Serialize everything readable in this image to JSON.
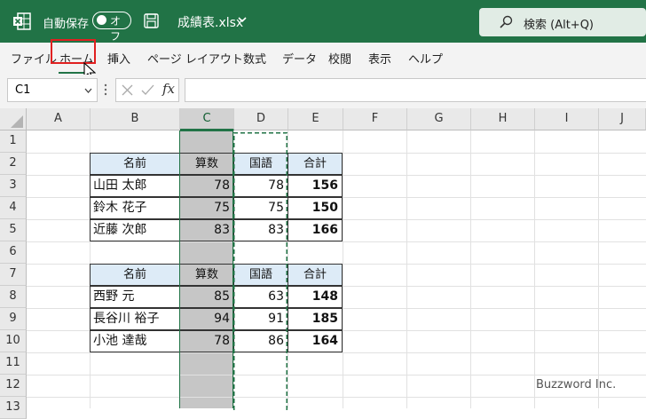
{
  "titlebar": {
    "autosave_label": "自動保存",
    "autosave_state": "オフ",
    "filename": "成績表.xlsx",
    "search_placeholder": "検索 (Alt+Q)",
    "brand_color": "#217346"
  },
  "menu": {
    "items": [
      "ファイル",
      "ホーム",
      "挿入",
      "ページ レイアウト",
      "数式",
      "データ",
      "校閲",
      "表示",
      "ヘルプ"
    ],
    "active": "ホーム"
  },
  "formula_bar": {
    "name_box": "C1",
    "fx": "fx",
    "formula": ""
  },
  "sheet": {
    "columns": [
      "A",
      "B",
      "C",
      "D",
      "E",
      "F",
      "G",
      "H",
      "I",
      "J"
    ],
    "rows": [
      "1",
      "2",
      "3",
      "4",
      "5",
      "6",
      "7",
      "8",
      "9",
      "10",
      "11",
      "12",
      "13"
    ],
    "selected_column": "C",
    "copied_column": "D",
    "table1": {
      "headers": [
        "名前",
        "算数",
        "国語",
        "合計"
      ],
      "rows": [
        [
          "山田 太郎",
          "78",
          "78",
          "156"
        ],
        [
          "鈴木 花子",
          "75",
          "75",
          "150"
        ],
        [
          "近藤 次郎",
          "83",
          "83",
          "166"
        ]
      ]
    },
    "table2": {
      "headers": [
        "名前",
        "算数",
        "国語",
        "合計"
      ],
      "rows": [
        [
          "西野 元",
          "85",
          "63",
          "148"
        ],
        [
          "長谷川 裕子",
          "94",
          "91",
          "185"
        ],
        [
          "小池 達哉",
          "78",
          "86",
          "164"
        ]
      ]
    }
  },
  "watermark": "Buzzword Inc."
}
